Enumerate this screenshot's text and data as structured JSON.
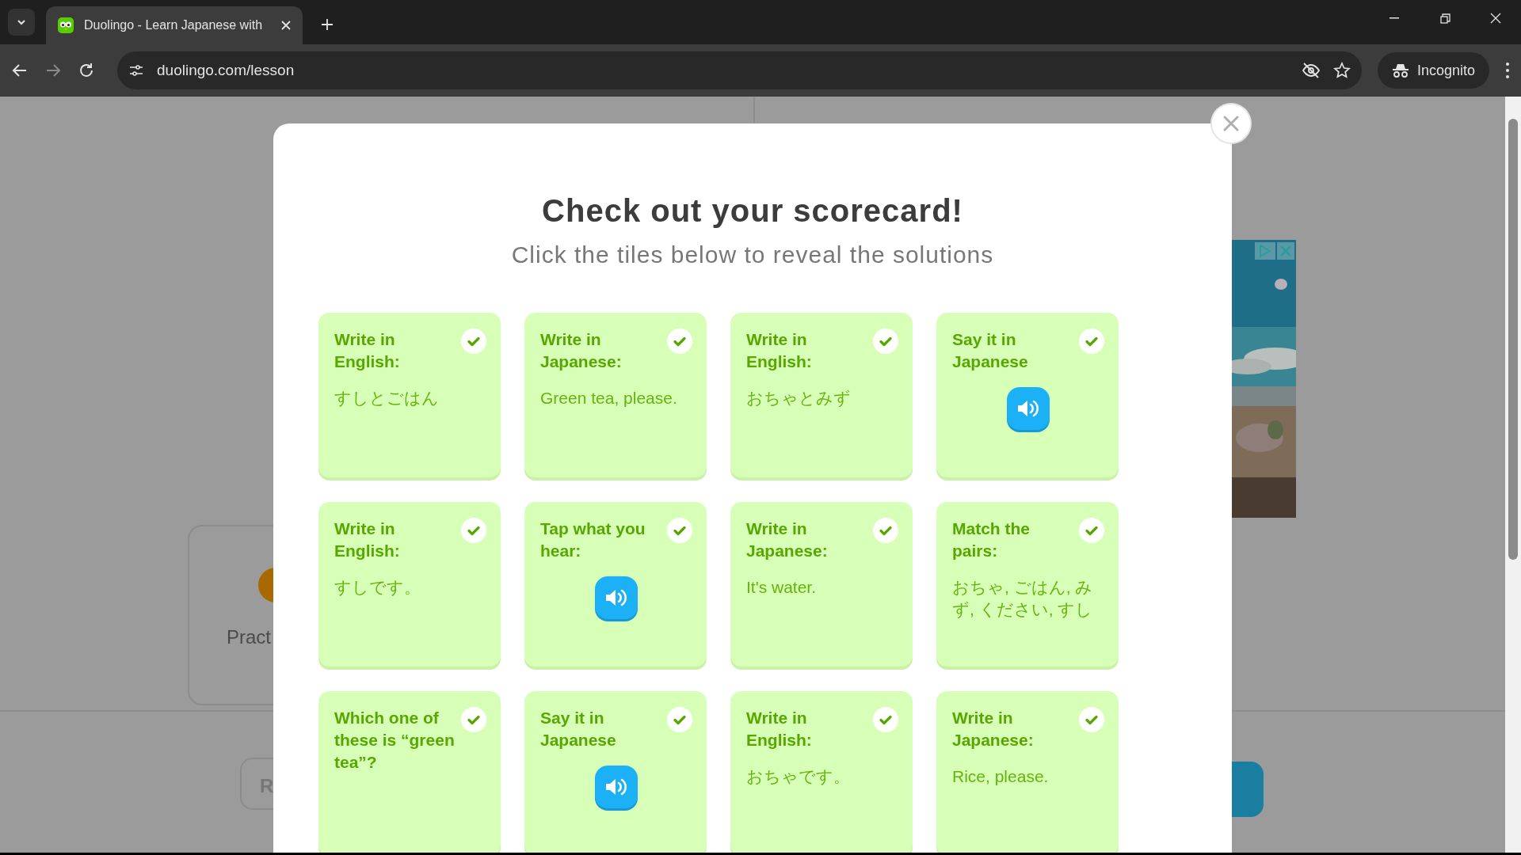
{
  "browser": {
    "tab_title": "Duolingo - Learn Japanese with",
    "url": "duolingo.com/lesson",
    "profile": "Incognito"
  },
  "background": {
    "card_text": "Pract",
    "button_text": "R"
  },
  "modal": {
    "title": "Check out your scorecard!",
    "subtitle": "Click the tiles below to reveal the solutions",
    "tiles": [
      {
        "kind": "text",
        "prompt": "Write in English:",
        "content": "すしとごはん",
        "checked": true
      },
      {
        "kind": "text",
        "prompt": "Write in Japanese:",
        "content": "Green tea, please.",
        "checked": true
      },
      {
        "kind": "text",
        "prompt": "Write in English:",
        "content": "おちゃとみず",
        "checked": true
      },
      {
        "kind": "audio",
        "prompt": "Say it in Japanese",
        "checked": true
      },
      {
        "kind": "text",
        "prompt": "Write in English:",
        "content": "すしです。",
        "checked": true
      },
      {
        "kind": "audio",
        "prompt": "Tap what you hear:",
        "checked": true
      },
      {
        "kind": "text",
        "prompt": "Write in Japanese:",
        "content": "It's water.",
        "checked": true
      },
      {
        "kind": "text",
        "prompt": "Match the pairs:",
        "content": "おちゃ, ごはん, みず, ください, すし",
        "checked": true
      },
      {
        "kind": "text",
        "prompt": "Which one of these is “green tea”?",
        "checked": true
      },
      {
        "kind": "audio",
        "prompt": "Say it in Japanese",
        "checked": true
      },
      {
        "kind": "text",
        "prompt": "Write in English:",
        "content": "おちゃです。",
        "checked": true
      },
      {
        "kind": "text",
        "prompt": "Write in Japanese:",
        "content": "Rice, please.",
        "checked": true
      }
    ]
  }
}
